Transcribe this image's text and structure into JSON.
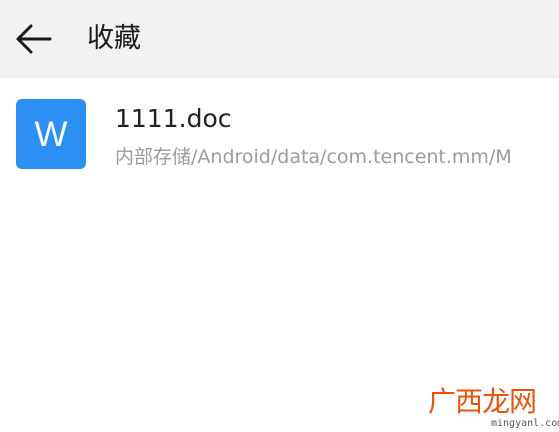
{
  "header": {
    "title": "收藏",
    "back_icon": "arrow-left-icon"
  },
  "files": [
    {
      "name": "1111.doc",
      "path": "内部存储/Android/data/com.tencent.mm/M",
      "icon_letter": "W",
      "icon_color": "#2b8ff4"
    }
  ],
  "watermark": {
    "main": "广西龙网",
    "sub": "mingyanl.com"
  }
}
